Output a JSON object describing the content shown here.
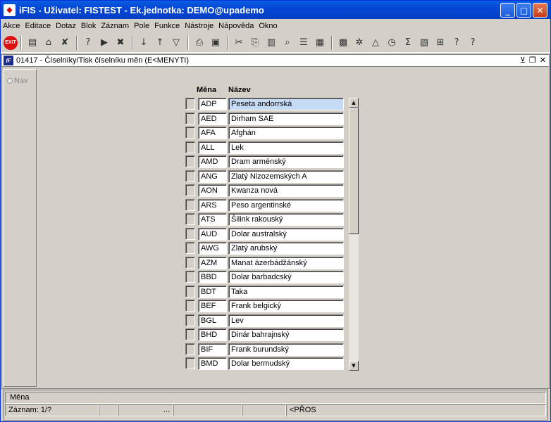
{
  "window": {
    "title": "iFIS - Uživatel: FISTEST - Ek.jednotka: DEMO@upademo",
    "app_icon": "iFIS-app-icon",
    "minimize": "_",
    "maximize": "□",
    "close": "✕"
  },
  "menu": [
    "Akce",
    "Editace",
    "Dotaz",
    "Blok",
    "Záznam",
    "Pole",
    "Funkce",
    "Nástroje",
    "Nápověda",
    "Okno"
  ],
  "toolbar": {
    "exit_label": "EXIT"
  },
  "form": {
    "title": "01417 - Číselníky/Tisk číselníku měn (E<MENYTI)",
    "nav_label": "Nav",
    "header_code": "Měna",
    "header_name": "Název"
  },
  "rows": [
    {
      "code": "ADP",
      "name": "Peseta andorrská"
    },
    {
      "code": "AED",
      "name": "Dirham SAE"
    },
    {
      "code": "AFA",
      "name": "Afghán"
    },
    {
      "code": "ALL",
      "name": "Lek"
    },
    {
      "code": "AMD",
      "name": "Dram arménský"
    },
    {
      "code": "ANG",
      "name": "Zlatý Nizozemských A"
    },
    {
      "code": "AON",
      "name": "Kwanza nová"
    },
    {
      "code": "ARS",
      "name": "Peso argentinské"
    },
    {
      "code": "ATS",
      "name": "Šilink rakouský"
    },
    {
      "code": "AUD",
      "name": "Dolar australský"
    },
    {
      "code": "AWG",
      "name": "Zlatý arubský"
    },
    {
      "code": "AZM",
      "name": "Manat ázerbádžánský"
    },
    {
      "code": "BBD",
      "name": "Dolar barbadcský"
    },
    {
      "code": "BDT",
      "name": "Taka"
    },
    {
      "code": "BEF",
      "name": "Frank belgický"
    },
    {
      "code": "BGL",
      "name": "Lev"
    },
    {
      "code": "BHD",
      "name": "Dinár bahrajnský"
    },
    {
      "code": "BIF",
      "name": "Frank burundský"
    },
    {
      "code": "BMD",
      "name": "Dolar bermudský"
    }
  ],
  "status": {
    "field": "Měna",
    "record": "Záznam: 1/?",
    "dots": "...",
    "mode": "<PŘOS"
  }
}
